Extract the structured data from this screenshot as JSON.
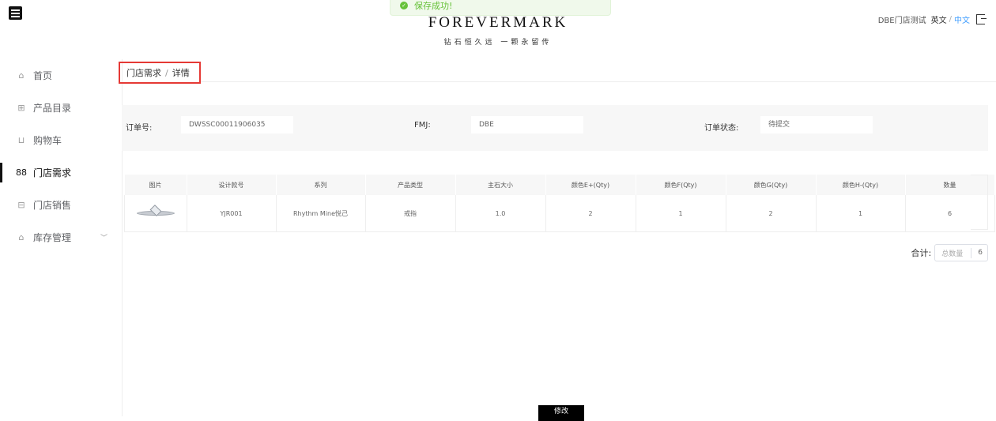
{
  "header": {
    "logo_main": "FOREVERMARK",
    "logo_sub": "钻石恒久远 一颗永留传",
    "toast": "保存成功!",
    "user": {
      "store": "DBE门店测试",
      "lang_en": "英文",
      "sep": "/",
      "lang_zh": "中文"
    }
  },
  "sidebar": {
    "items": [
      {
        "label": "首页",
        "icon": "⌂"
      },
      {
        "label": "产品目录",
        "icon": "⊞"
      },
      {
        "label": "购物车",
        "icon": "⊔"
      },
      {
        "label": "门店需求",
        "icon": "88"
      },
      {
        "label": "门店销售",
        "icon": "⊟"
      },
      {
        "label": "库存管理",
        "icon": "⌂",
        "chevron": "﹀"
      }
    ]
  },
  "breadcrumb": {
    "parent": "门店需求",
    "sep": "/",
    "current": "详情"
  },
  "order": {
    "no_label": "订单号:",
    "no_value": "DWSSC00011906035",
    "fmj_label": "FMJ:",
    "fmj_value": "DBE",
    "status_label": "订单状态:",
    "status_value": "待提交"
  },
  "table": {
    "headers": [
      "图片",
      "设计款号",
      "系列",
      "产品类型",
      "主石大小",
      "颜色E+(Qty)",
      "颜色F(Qty)",
      "颜色G(Qty)",
      "颜色H-(Qty)",
      "数量"
    ],
    "rows": [
      {
        "design": "YJR001",
        "series": "Rhythm Mine悦己",
        "type": "戒指",
        "size": "1.0",
        "e": "2",
        "f": "1",
        "g": "2",
        "h": "1",
        "qty": "6"
      }
    ]
  },
  "total": {
    "label": "合计:",
    "placeholder": "总数量",
    "value": "6"
  },
  "actions": {
    "edit": "修改"
  }
}
